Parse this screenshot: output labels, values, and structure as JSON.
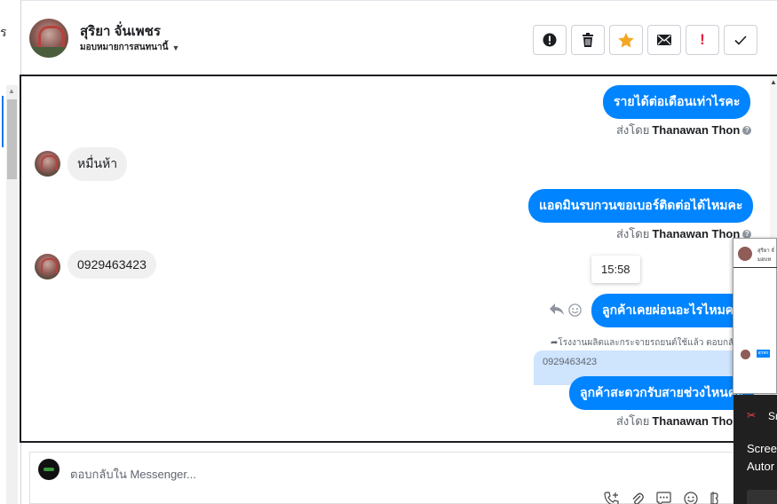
{
  "sidebar": {
    "cut_text": "ร"
  },
  "header": {
    "contact_name": "สุริยา จั่นเพชร",
    "assign_label": "มอบหมายการสนทนานี้",
    "actions": [
      {
        "name": "alert-icon",
        "glyph": "●"
      },
      {
        "name": "trash-icon",
        "glyph": "🗑"
      },
      {
        "name": "star-icon",
        "glyph": "★"
      },
      {
        "name": "mail-icon",
        "glyph": "✉"
      },
      {
        "name": "exclamation-icon",
        "glyph": "!"
      },
      {
        "name": "check-icon",
        "glyph": "✓"
      }
    ]
  },
  "messages": {
    "m1": {
      "text": "รายได้ต่อเดือนเท่าไรคะ",
      "sent_prefix": "ส่งโดย",
      "sender": "Thanawan Thon"
    },
    "m2": {
      "text": "หมื่นห้า"
    },
    "m3": {
      "text": "แอดมินรบกวนขอเบอร์ติดต่อได้ไหมคะ",
      "sent_prefix": "ส่งโดย",
      "sender": "Thanawan Thon"
    },
    "m4": {
      "text": "0929463423"
    },
    "tooltip_time": "15:58",
    "m5": {
      "text": "ลูกค้าเคยผ่อนอะไรไหมคะ"
    },
    "reply_context": "โรงงานผลิตและกระจายรถยนต์ใช้แล้ว ตอบกลับ สุ",
    "quoted": "0929463423",
    "m6": {
      "text": "ลูกค้าสะดวกรับสายช่วงไหนคะ",
      "sent_prefix": "ส่งโดย",
      "sender": "Thanawan Thon"
    }
  },
  "composer": {
    "placeholder": "ตอบกลับใน Messenger..."
  },
  "overlay_mini": {
    "title_line1": "สุริยา จั่",
    "title_line2": "มอบห",
    "badge": "สุรพร"
  },
  "overlay_dark": {
    "title": "Sn",
    "line1": "Scree",
    "line2": "Autor"
  }
}
